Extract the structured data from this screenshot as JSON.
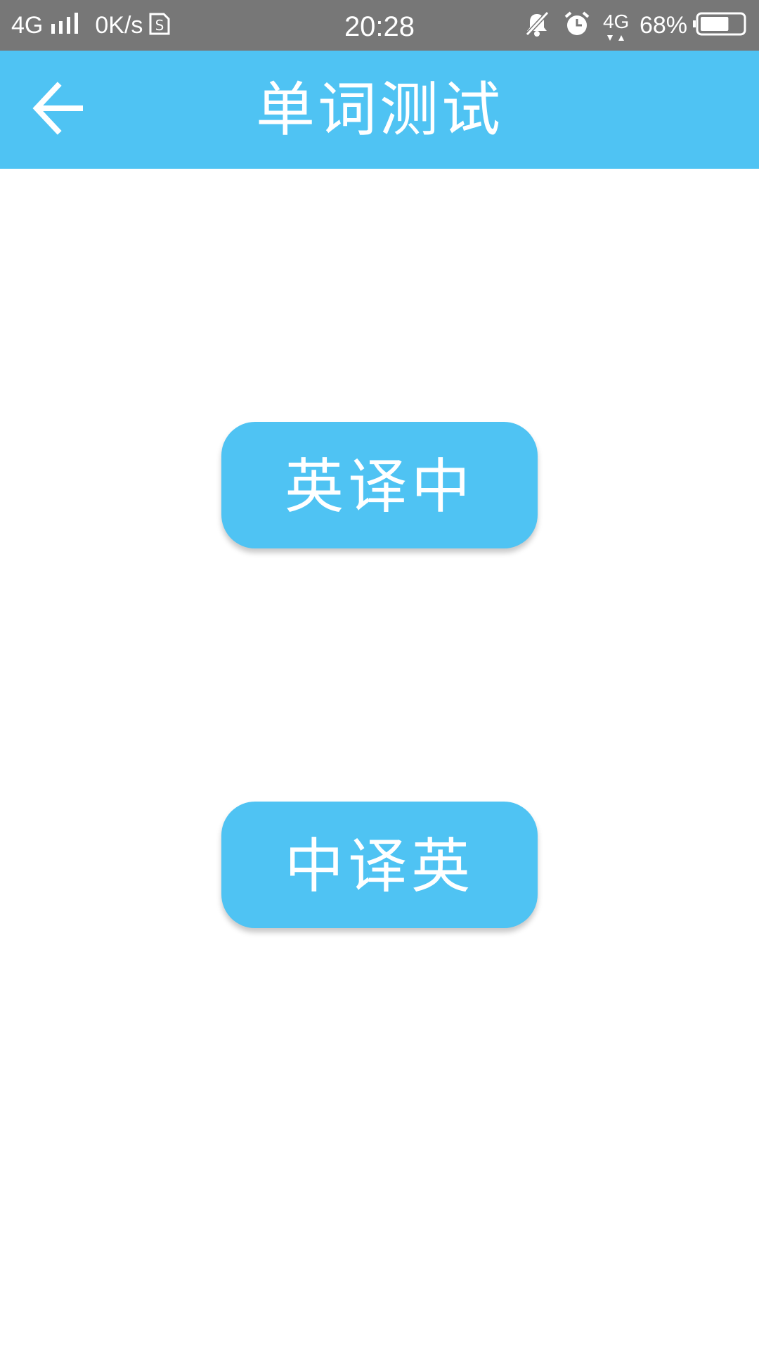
{
  "status_bar": {
    "network_left": "4G",
    "speed": "0K/s",
    "time": "20:28",
    "network_right": "4G",
    "battery": "68%",
    "battery_level": 0.68,
    "icons": [
      "signal-icon",
      "sim-s-icon",
      "bell-off-icon",
      "alarm-icon",
      "battery-icon"
    ]
  },
  "header": {
    "title": "单词测试",
    "back_icon": "arrow-left-icon"
  },
  "main": {
    "buttons": [
      {
        "label": "英译中"
      },
      {
        "label": "中译英"
      }
    ]
  },
  "colors": {
    "accent": "#4fc3f3",
    "status_bar": "#777777",
    "text_on_accent": "#ffffff"
  }
}
